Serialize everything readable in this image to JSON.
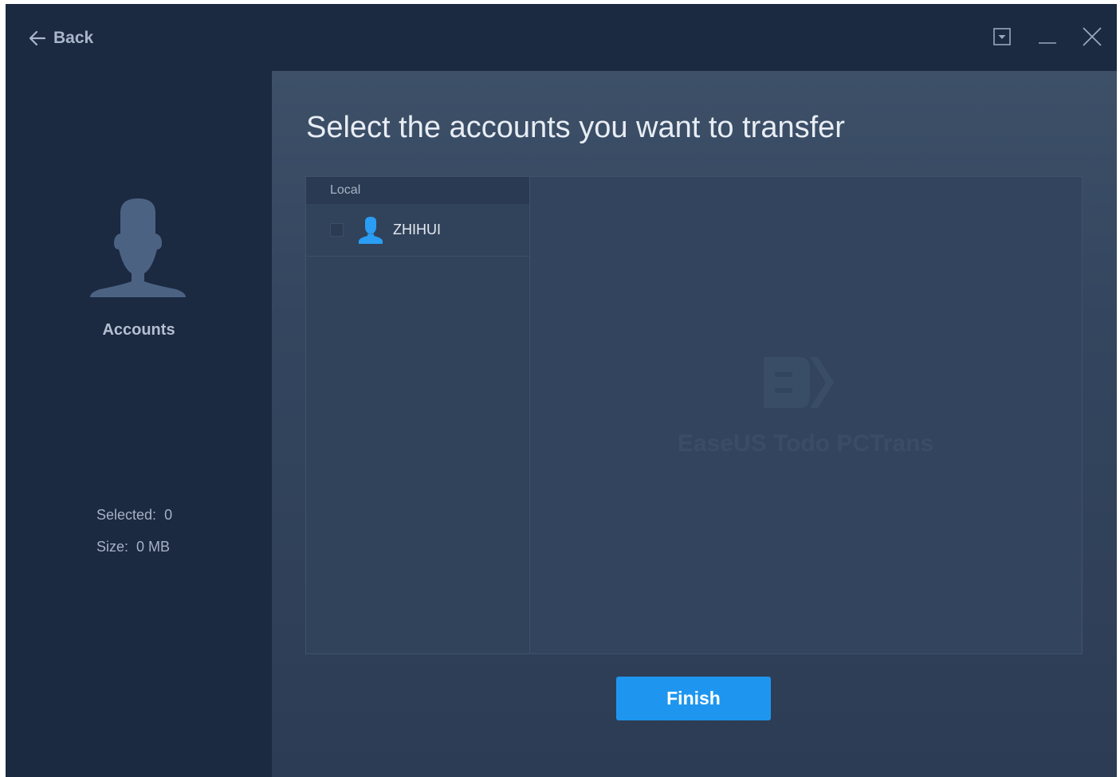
{
  "titlebar": {
    "back_label": "Back",
    "icons": [
      "arrow-left-icon",
      "dropdown-box-icon",
      "minimize-icon",
      "close-icon"
    ]
  },
  "sidebar": {
    "title": "Accounts",
    "selected_label": "Selected:",
    "selected_value": "0",
    "size_label": "Size:",
    "size_value": "0 MB"
  },
  "main": {
    "title": "Select the accounts you want to transfer",
    "column_header": "Local",
    "accounts": [
      {
        "name": "ZHIHUI",
        "checked": false
      }
    ],
    "watermark": "EaseUS Todo PCTrans",
    "finish_label": "Finish"
  },
  "colors": {
    "window_bg": "#1b2941",
    "main_bg": "#34465f",
    "accent": "#1e96f0",
    "user_icon": "#2a9df4"
  }
}
